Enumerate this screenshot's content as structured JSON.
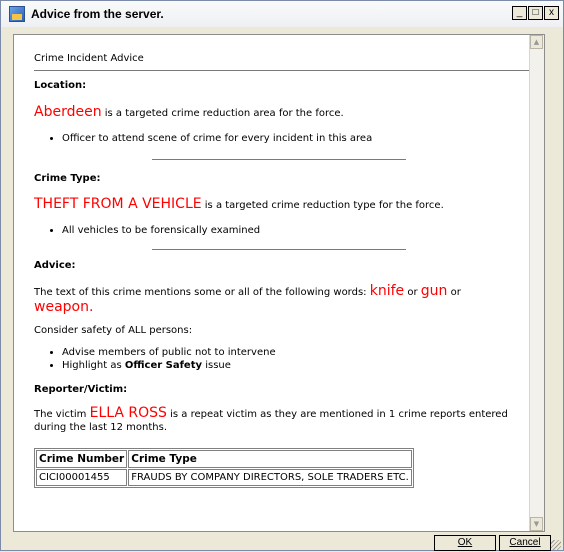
{
  "window": {
    "title": "Advice from the server.",
    "min_label": "_",
    "max_label": "□",
    "close_label": "x"
  },
  "doc": {
    "heading": "Crime Incident Advice",
    "location": {
      "title": "Location:",
      "place": "Aberdeen",
      "text": "is a targeted crime reduction area for the force.",
      "bullets": [
        "Officer to attend scene of crime for every incident in this area"
      ]
    },
    "crime_type": {
      "title": "Crime Type:",
      "type": "THEFT FROM A VEHICLE",
      "text": "is a targeted crime reduction type for the force.",
      "bullets": [
        "All vehicles to be forensically examined"
      ]
    },
    "advice": {
      "title": "Advice:",
      "intro": "The text of this crime mentions some or all of the following words:",
      "word1": "knife",
      "or1": "or",
      "word2": "gun",
      "or2": "or",
      "word3": "weapon",
      "period": ".",
      "consider": "Consider safety of ALL persons:",
      "bullet1": "Advise members of public not to intervene",
      "bullet2_pre": "Highlight as",
      "bullet2_bold": "Officer Safety",
      "bullet2_post": "issue"
    },
    "reporter": {
      "title": "Reporter/Victim:",
      "pre": "The victim",
      "name": "ELLA ROSS",
      "post": "is a repeat victim as they are mentioned in 1 crime reports entered during the last 12 months.",
      "table": {
        "headers": [
          "Crime Number",
          "Crime Type"
        ],
        "rows": [
          [
            "CICI00001455",
            "FRAUDS BY COMPANY DIRECTORS, SOLE TRADERS ETC."
          ]
        ]
      }
    }
  },
  "buttons": {
    "ok": "OK",
    "cancel": "Cancel"
  },
  "colors": {
    "highlight": "#ff0000"
  }
}
